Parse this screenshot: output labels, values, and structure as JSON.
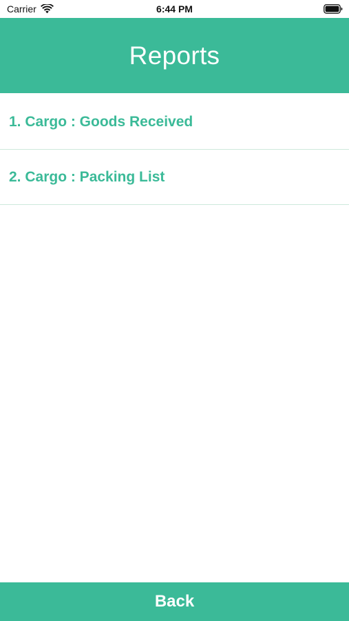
{
  "status_bar": {
    "carrier": "Carrier",
    "time": "6:44 PM",
    "wifi_icon": "wifi-icon",
    "battery_icon": "battery-full-icon"
  },
  "header": {
    "title": "Reports"
  },
  "reports": {
    "items": [
      {
        "label": "1. Cargo : Goods Received"
      },
      {
        "label": "2. Cargo : Packing List"
      }
    ]
  },
  "footer": {
    "back_label": "Back"
  },
  "colors": {
    "accent": "#3bba98",
    "divider": "#cde9db",
    "text_on_accent": "#ffffff"
  }
}
